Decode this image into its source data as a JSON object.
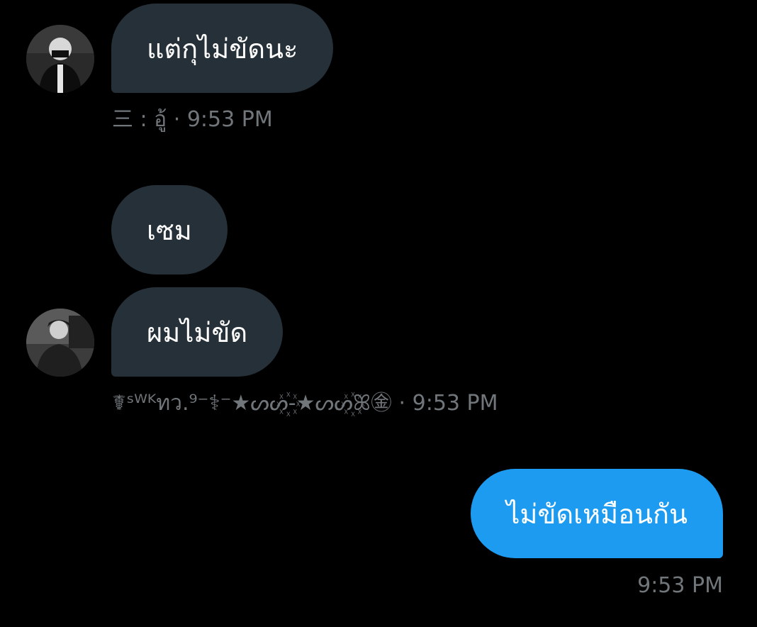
{
  "messages": [
    {
      "direction": "incoming",
      "text": "แต่กุไม่ขัดนะ",
      "sender": "三 : อู้",
      "time": "9:53 PM",
      "has_avatar": true
    },
    {
      "direction": "incoming",
      "text": "เซม",
      "has_avatar": false
    },
    {
      "direction": "incoming",
      "text": "ผมไม่ขัด",
      "sender": "☤ˢᵂᴷทว.⁹⁻⚕⁻★ᔕᔕ꙰-★ᔕᔕ꙰ꕤ㊎",
      "time": "9:53 PM",
      "has_avatar": true
    },
    {
      "direction": "outgoing",
      "text": "ไม่ขัดเหมือนกัน",
      "time": "9:53 PM"
    }
  ],
  "separator": "·",
  "colors": {
    "background": "#000000",
    "incoming_bubble": "#253038",
    "outgoing_bubble": "#1d9bf0",
    "meta_text": "#71767b",
    "bubble_text": "#ffffff"
  },
  "icons": [
    "avatar-photo-1",
    "avatar-photo-2"
  ]
}
